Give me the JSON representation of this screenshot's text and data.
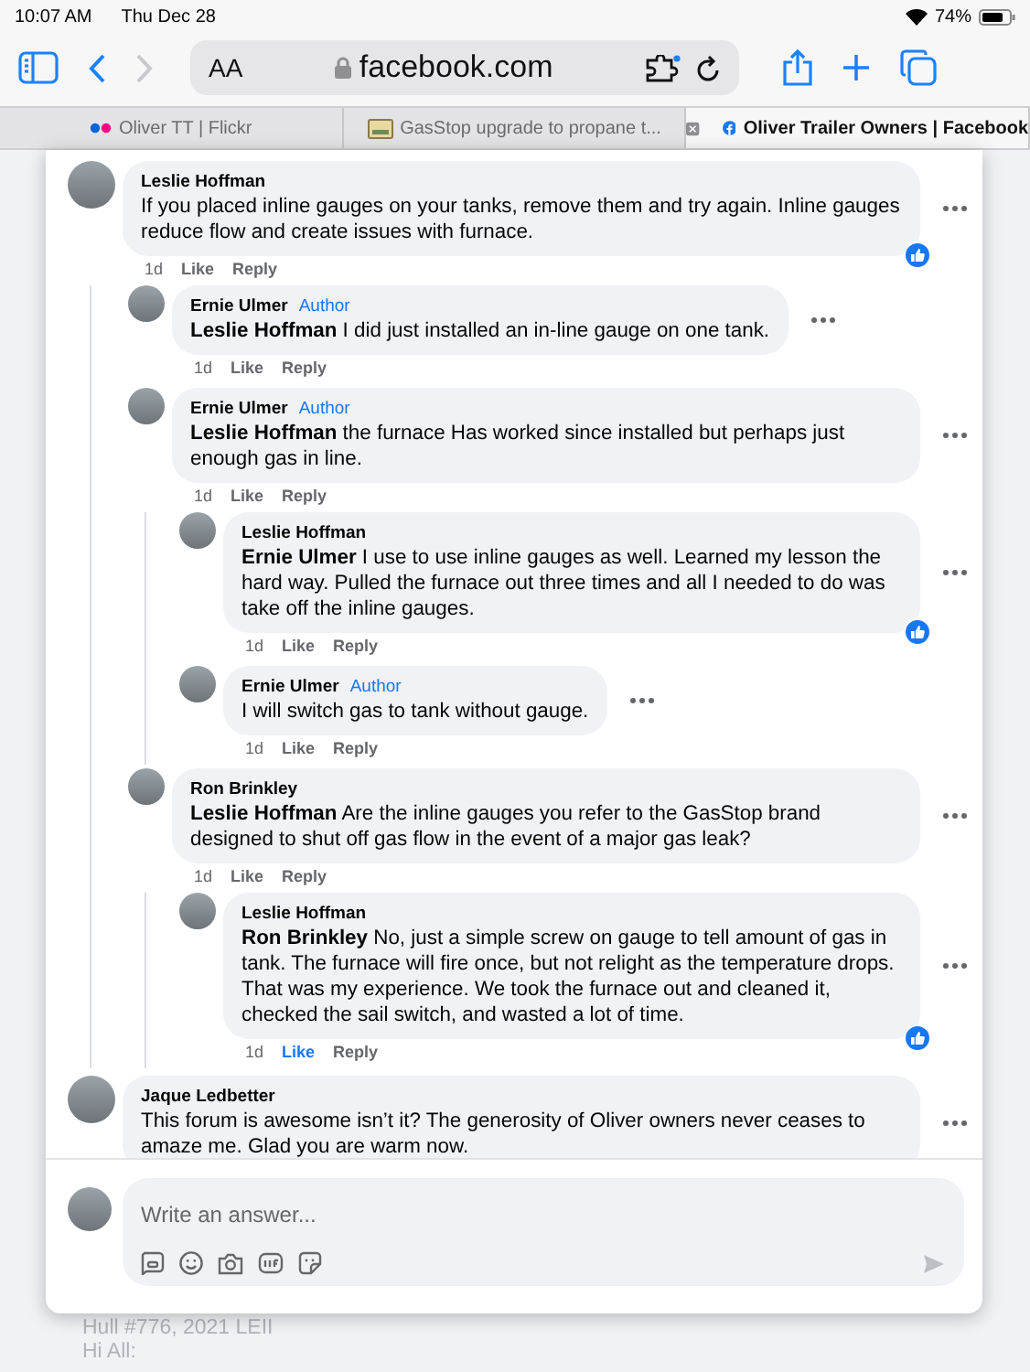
{
  "status_bar": {
    "time": "10:07 AM",
    "date": "Thu Dec 28",
    "battery": "74%"
  },
  "toolbar": {
    "text_size": "AA",
    "address": "facebook.com",
    "forward_disabled": true
  },
  "tabs": [
    {
      "label": "Oliver TT | Flickr",
      "kind": "flickr",
      "selected": false
    },
    {
      "label": "GasStop upgrade to propane t...",
      "kind": "page",
      "selected": false
    },
    {
      "label": "Oliver Trailer Owners | Facebook",
      "kind": "facebook",
      "selected": true
    }
  ],
  "comments": [
    {
      "name": "Leslie Hoffman",
      "text": "If you placed inline gauges on your tanks, remove them and try again. Inline gauges reduce flow and create issues with furnace.",
      "time": "1d",
      "like": "Like",
      "reply": "Reply",
      "liked": false,
      "reacted": true,
      "children": [
        {
          "name": "Ernie Ulmer",
          "badge": "Author",
          "text": "**Leslie Hoffman** I did just installed an in-line gauge on one tank.",
          "time": "1d",
          "like": "Like",
          "reply": "Reply",
          "liked": false,
          "reacted": false
        },
        {
          "name": "Ernie Ulmer",
          "badge": "Author",
          "text": "**Leslie Hoffman** the furnace Has worked since installed but perhaps just enough gas in line.",
          "time": "1d",
          "like": "Like",
          "reply": "Reply",
          "liked": false,
          "reacted": false,
          "children": [
            {
              "name": "Leslie Hoffman",
              "text": "**Ernie Ulmer** I use to use inline gauges as well. Learned my lesson the hard way. Pulled the furnace out three times and all I needed to do was take off the inline gauges.",
              "time": "1d",
              "like": "Like",
              "reply": "Reply",
              "liked": false,
              "reacted": true
            },
            {
              "name": "Ernie Ulmer",
              "badge": "Author",
              "text": "I will switch gas to tank without gauge.",
              "time": "1d",
              "like": "Like",
              "reply": "Reply",
              "liked": false,
              "reacted": false
            }
          ]
        },
        {
          "name": "Ron Brinkley",
          "text": "**Leslie Hoffman** Are the inline gauges you refer to the GasStop brand designed to shut off gas flow in the event of a major gas leak?",
          "time": "1d",
          "like": "Like",
          "reply": "Reply",
          "liked": false,
          "reacted": false,
          "children": [
            {
              "name": "Leslie Hoffman",
              "text": "**Ron Brinkley** No, just a simple screw on gauge to tell amount of gas in tank. The furnace will fire once, but not relight as the temperature drops. That was my experience. We took the furnace out and cleaned it, checked the sail switch, and wasted a lot of time.",
              "time": "1d",
              "like": "Like",
              "reply": "Reply",
              "liked": true,
              "reacted": true
            }
          ]
        }
      ]
    },
    {
      "name": "Jaque Ledbetter",
      "text": "This forum is awesome isn’t it? The generosity of Oliver owners never ceases to amaze me. Glad you are warm now.",
      "reacted": false
    }
  ],
  "composer": {
    "placeholder": "Write an answer..."
  },
  "background_post": {
    "line_1": "Hull #776, 2021 LEII",
    "line_2": "Hi All:"
  }
}
